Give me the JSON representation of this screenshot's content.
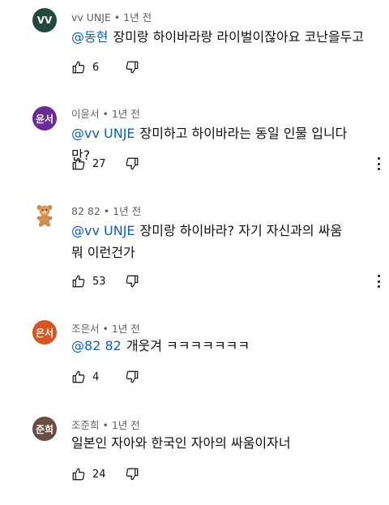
{
  "comments": [
    {
      "avatar_text": "VV",
      "avatar_color": "#1f4a3c",
      "author": "vv UNJE",
      "sep": "•",
      "time": "1년 전",
      "mention": "@동현",
      "text": "장미랑 하이바라랑 라이벌이잖아요 코난을두고",
      "likes": "6"
    },
    {
      "avatar_text": "윤서",
      "avatar_color": "#6b2a9a",
      "author": "이윤서",
      "sep": "•",
      "time": "1년 전",
      "mention": "@vv UNJE",
      "text": "장미하고 하이바라는 동일 인물 입니다만?",
      "likes": "27"
    },
    {
      "avatar_text": "",
      "avatar_icon": "teddy-bear-icon",
      "author": "82 82",
      "sep": "•",
      "time": "1년 전",
      "mention": "@vv UNJE",
      "text": "장미랑 하이바라? 자기 자신과의 싸움 뭐 이런건가",
      "likes": "53"
    },
    {
      "avatar_text": "은서",
      "avatar_color": "#d9541e",
      "author": "조은서",
      "sep": "•",
      "time": "1년 전",
      "mention": "@82 82",
      "text": "개웃겨 ㅋㅋㅋㅋㅋㅋㅋ",
      "likes": "4"
    },
    {
      "avatar_text": "준희",
      "avatar_color": "#6d4c41",
      "author": "조준희",
      "sep": "•",
      "time": "1년 전",
      "mention": "",
      "text": "일본인 자아와 한국인 자아의 싸움이자너",
      "likes": "24"
    }
  ],
  "colors": {
    "mention": "#065fd4",
    "meta": "#606060",
    "text": "#0f0f0f"
  }
}
